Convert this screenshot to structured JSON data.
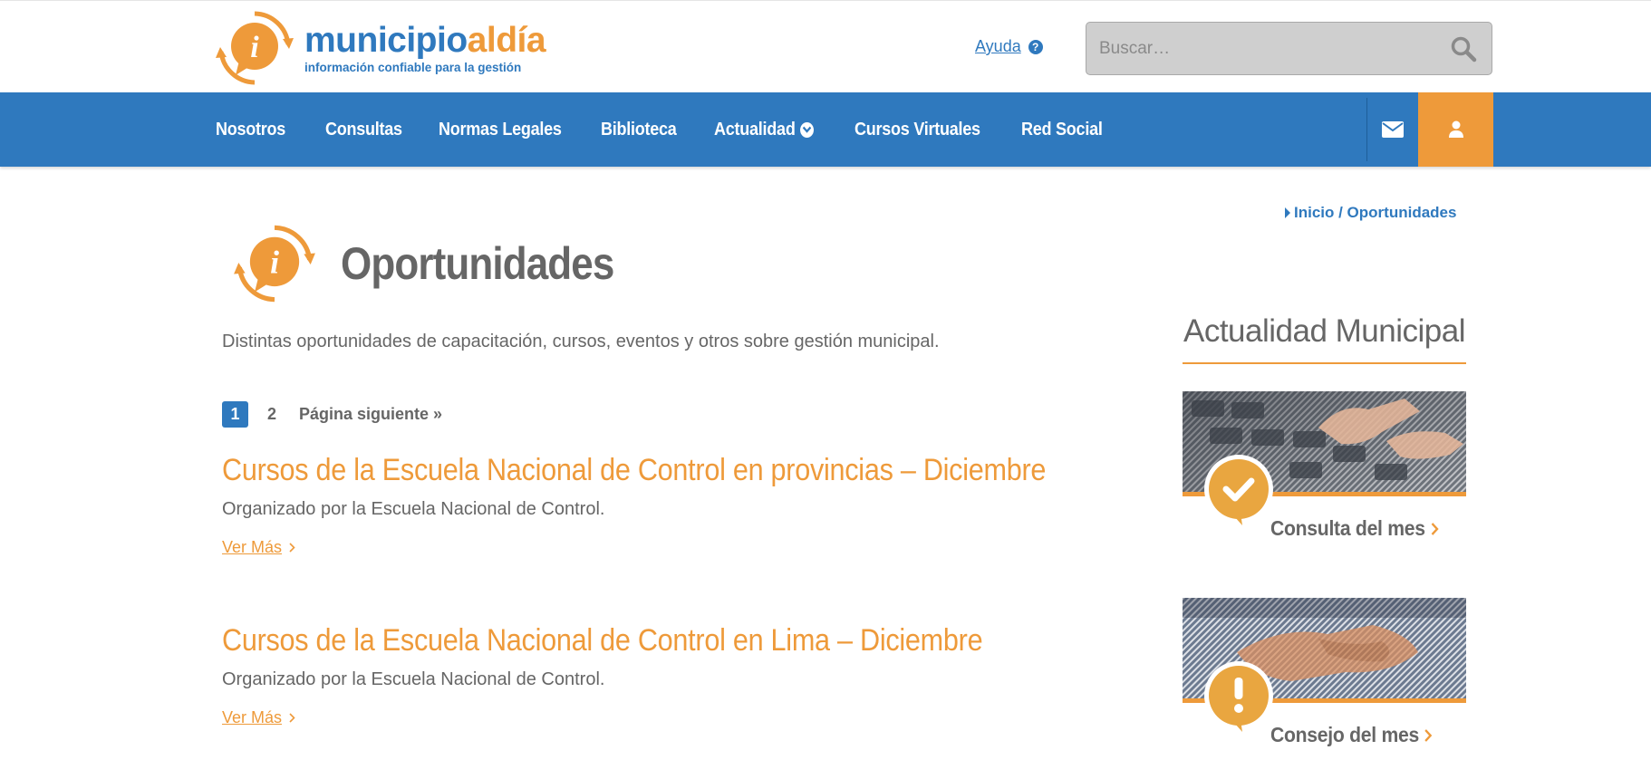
{
  "header": {
    "logo": {
      "name_part1": "municipio",
      "name_part2": "aldía",
      "tagline": "información confiable para la gestión"
    },
    "help_label": "Ayuda",
    "search": {
      "placeholder": "Buscar…"
    }
  },
  "nav": {
    "items": [
      {
        "label": "Nosotros"
      },
      {
        "label": "Consultas"
      },
      {
        "label": "Normas Legales"
      },
      {
        "label": "Biblioteca"
      },
      {
        "label": "Actualidad",
        "dropdown": true
      },
      {
        "label": "Cursos Virtuales"
      },
      {
        "label": "Red Social"
      }
    ],
    "icons": [
      "envelope-icon",
      "user-icon"
    ]
  },
  "breadcrumb": {
    "text": "Inicio / Oportunidades"
  },
  "page": {
    "title": "Oportunidades",
    "intro": "Distintas oportunidades de capacitación, cursos, eventos y otros sobre gestión municipal."
  },
  "pagination": {
    "current": "1",
    "next_page": "2",
    "next_label": "Página siguiente »"
  },
  "posts": [
    {
      "title": "Cursos de la Escuela Nacional de Control en provincias – Diciembre",
      "description": "Organizado por la Escuela Nacional de Control.",
      "more": "Ver Más"
    },
    {
      "title": "Cursos de la Escuela Nacional de Control en Lima – Diciembre",
      "description": "Organizado por la Escuela Nacional de Control.",
      "more": "Ver Más"
    }
  ],
  "sidebar": {
    "title": "Actualidad Municipal",
    "cards": [
      {
        "label": "Consulta del mes",
        "icon": "check-icon"
      },
      {
        "label": "Consejo del mes",
        "icon": "exclamation-icon"
      }
    ]
  },
  "colors": {
    "brand_blue": "#2f79be",
    "brand_orange": "#ee9a3a"
  }
}
